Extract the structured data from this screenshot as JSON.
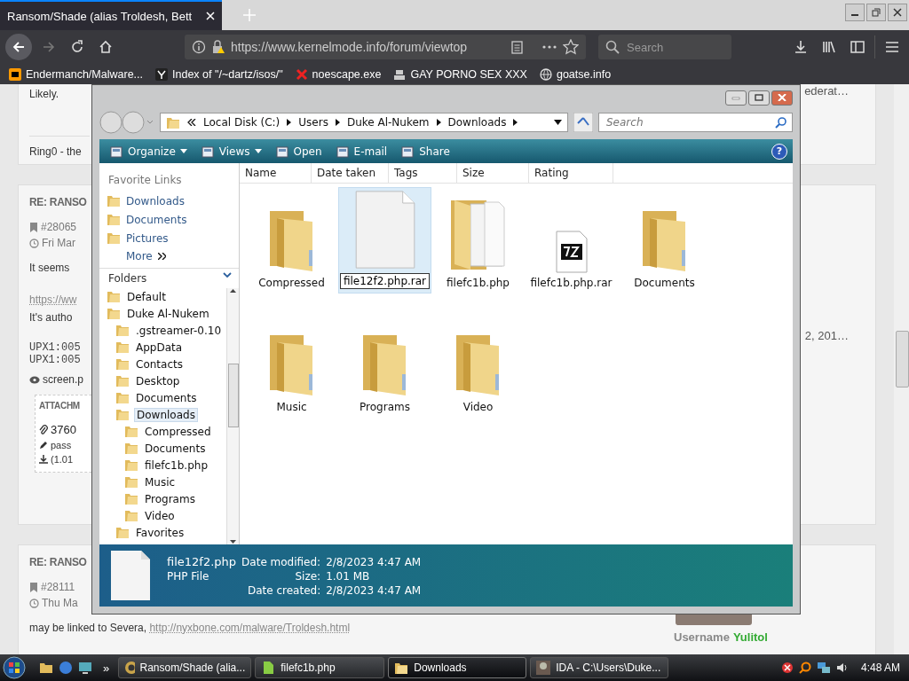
{
  "browser": {
    "tab_title": "Ransom/Shade (alias Troldesh, Bett",
    "url": "https://www.kernelmode.info/forum/viewtop",
    "search_placeholder": "Search",
    "bookmarks": [
      {
        "label": "Endermanch/Malware...",
        "kind": "ph"
      },
      {
        "label": "Index of \"/~dartz/isos/\"",
        "kind": "yp"
      },
      {
        "label": "noescape.exe",
        "kind": "x"
      },
      {
        "label": "GAY PORNO SEX XXX",
        "kind": "stamp"
      },
      {
        "label": "goatse.info",
        "kind": "globe"
      }
    ]
  },
  "forum": {
    "posts": [
      {
        "lines": [
          {
            "kind": "text",
            "text": "Likely."
          },
          {
            "kind": "sig",
            "text": "Ring0 - the"
          }
        ],
        "right_text": "ederat…"
      },
      {
        "heading": "RE: RANSO",
        "post_id": "#28065",
        "date": "Fri Mar",
        "lines": [
          {
            "kind": "text",
            "text": "It seems"
          },
          {
            "kind": "link",
            "text": "https://ww"
          },
          {
            "kind": "text",
            "text": "It's autho"
          },
          {
            "kind": "mono",
            "text": "UPX1:005"
          },
          {
            "kind": "mono",
            "text": "UPX1:005"
          },
          {
            "kind": "eye",
            "text": "screen.p"
          }
        ],
        "right_text": "2, 201…",
        "attachment": {
          "title": "ATTACHM",
          "name": "3760",
          "note": "pass",
          "size": "(1.01"
        }
      },
      {
        "heading": "RE: RANSO",
        "post_id": "#28111",
        "date": "Thu Ma",
        "lines": [
          {
            "kind": "text",
            "text": "may be linked to Severa,",
            "link": "http://nyxbone.com/malware/Troldesh.html"
          }
        ],
        "username_label": "Username",
        "username": "Yulitol"
      }
    ]
  },
  "explorer": {
    "breadcrumb": [
      "Local Disk (C:)",
      "Users",
      "Duke Al-Nukem",
      "Downloads"
    ],
    "search_placeholder": "Search",
    "toolbar": [
      {
        "label": "Organize",
        "menu": true
      },
      {
        "label": "Views",
        "menu": true
      },
      {
        "label": "Open",
        "menu": false
      },
      {
        "label": "E-mail",
        "menu": false
      },
      {
        "label": "Share",
        "menu": false
      }
    ],
    "help": "?",
    "favorite_links": {
      "title": "Favorite Links",
      "items": [
        "Downloads",
        "Documents",
        "Pictures"
      ],
      "more": "More"
    },
    "folders_title": "Folders",
    "tree": [
      {
        "label": "Default",
        "selected": false
      },
      {
        "label": "Duke Al-Nukem",
        "selected": false,
        "children": [
          {
            "label": ".gstreamer-0.10",
            "selected": false
          },
          {
            "label": "AppData",
            "selected": false
          },
          {
            "label": "Contacts",
            "selected": false
          },
          {
            "label": "Desktop",
            "selected": false
          },
          {
            "label": "Documents",
            "selected": false
          },
          {
            "label": "Downloads",
            "selected": true,
            "children": [
              {
                "label": "Compressed",
                "selected": false
              },
              {
                "label": "Documents",
                "selected": false
              },
              {
                "label": "filefc1b.php",
                "selected": false
              },
              {
                "label": "Music",
                "selected": false
              },
              {
                "label": "Programs",
                "selected": false
              },
              {
                "label": "Video",
                "selected": false
              }
            ]
          },
          {
            "label": "Favorites",
            "selected": false
          }
        ]
      }
    ],
    "columns": [
      "Name",
      "Date taken",
      "Tags",
      "Size",
      "Rating"
    ],
    "items": [
      {
        "name": "Compressed",
        "kind": "folder",
        "selected": false,
        "editing": false
      },
      {
        "name": "file12f2.php.rar",
        "kind": "file",
        "selected": true,
        "editing": true
      },
      {
        "name": "filefc1b.php",
        "kind": "stack",
        "selected": false,
        "editing": false
      },
      {
        "name": "filefc1b.php.rar",
        "kind": "archive",
        "selected": false,
        "editing": false
      },
      {
        "name": "Documents",
        "kind": "folder",
        "selected": false,
        "editing": false
      },
      {
        "name": "Music",
        "kind": "folder",
        "selected": false,
        "editing": false
      },
      {
        "name": "Programs",
        "kind": "folder",
        "selected": false,
        "editing": false
      },
      {
        "name": "Video",
        "kind": "folder",
        "selected": false,
        "editing": false
      }
    ],
    "details": {
      "name": "file12f2.php",
      "type": "PHP File",
      "fields": [
        {
          "label": "Date modified:",
          "value": "2/8/2023 4:47 AM"
        },
        {
          "label": "Size:",
          "value": "1.01 MB"
        },
        {
          "label": "Date created:",
          "value": "2/8/2023 4:47 AM"
        }
      ]
    }
  },
  "taskbar": {
    "chevron": "»",
    "buttons": [
      {
        "label": "Ransom/Shade (alia...",
        "kind": "browser",
        "selected": false
      },
      {
        "label": "filefc1b.php",
        "kind": "stack",
        "selected": false
      },
      {
        "label": "Downloads",
        "kind": "folder",
        "selected": true
      },
      {
        "label": "IDA - C:\\Users\\Duke...",
        "kind": "ida",
        "selected": false
      }
    ],
    "clock": "4:48 AM"
  }
}
